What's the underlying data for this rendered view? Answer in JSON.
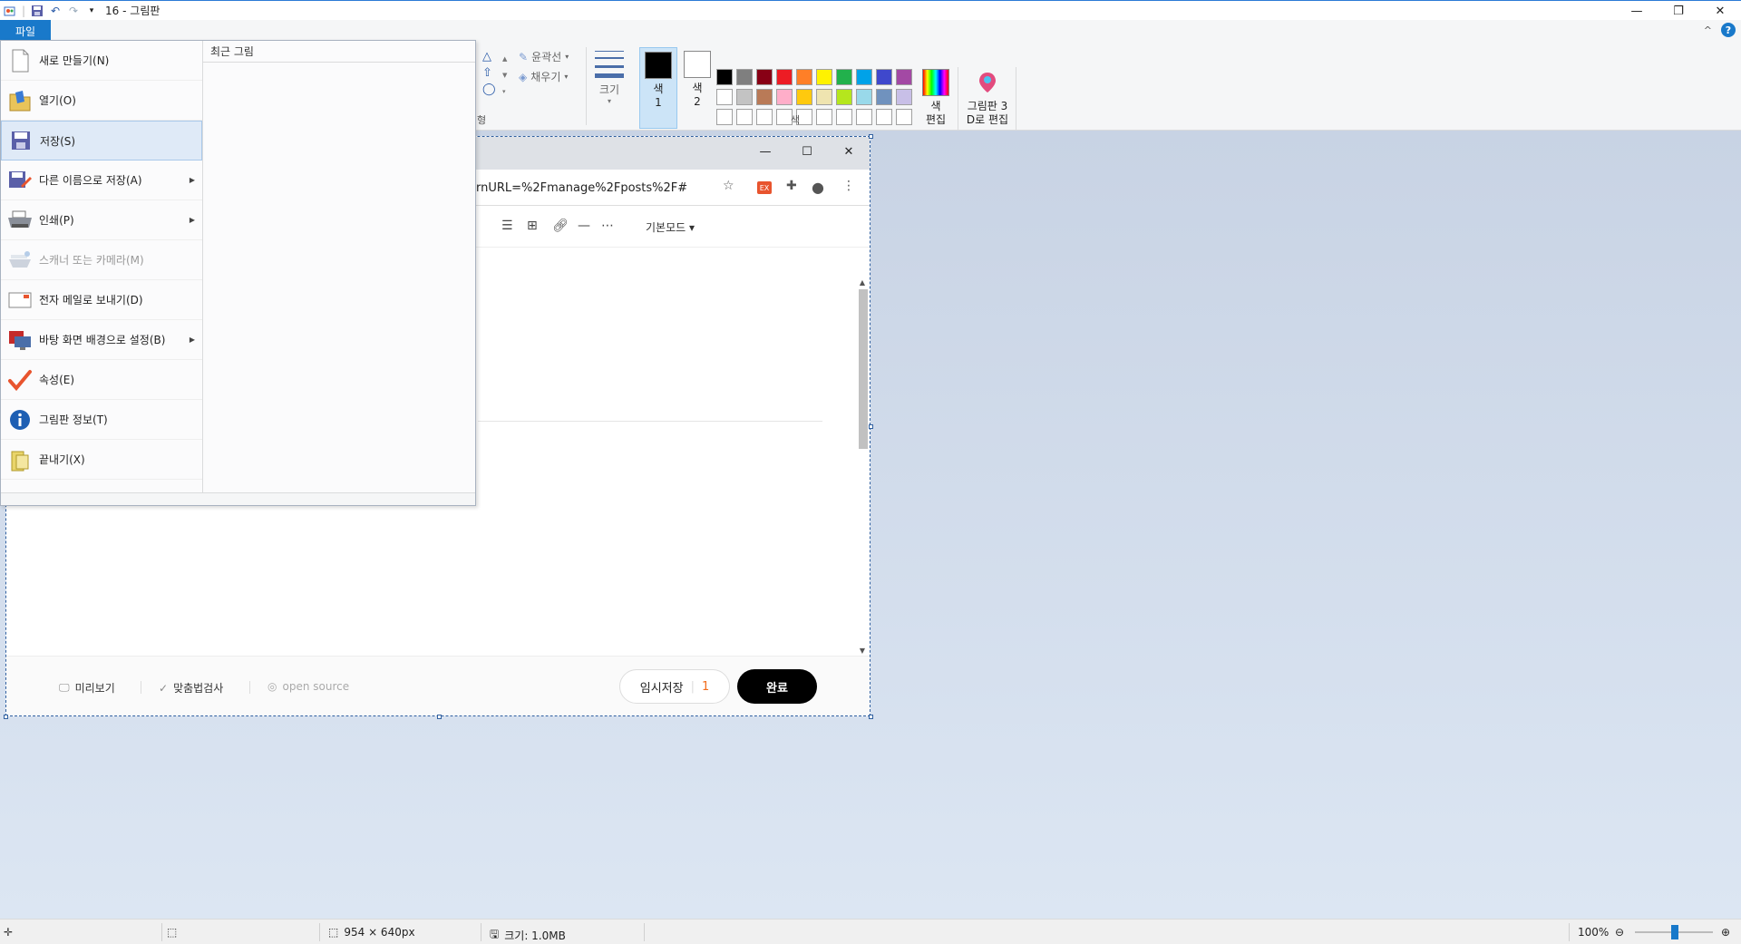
{
  "window": {
    "title": "16 - 그림판",
    "minimize": "—",
    "restore": "❐",
    "close": "✕"
  },
  "ribbon": {
    "file_tab": "파일",
    "collapse": "^",
    "help": "?",
    "shapes_caption": "형",
    "outline_label": "윤곽선",
    "fill_label": "채우기",
    "size_label": "크기",
    "color1_label_a": "색",
    "color1_label_b": "1",
    "color2_label_a": "색",
    "color2_label_b": "2",
    "colors_caption": "색",
    "edit_colors_a": "색",
    "edit_colors_b": "편집",
    "paint3d_a": "그림판 3",
    "paint3d_b": "D로 편집",
    "palette": [
      "#000000",
      "#7f7f7f",
      "#880015",
      "#ed1c24",
      "#ff7f27",
      "#fff200",
      "#22b14c",
      "#00a2e8",
      "#3f48cc",
      "#a349a4",
      "#ffffff",
      "#c3c3c3",
      "#b97a57",
      "#ffaec9",
      "#ffc90e",
      "#efe4b0",
      "#b5e61d",
      "#99d9ea",
      "#7092be",
      "#c8bfe7",
      "#ffffff",
      "#ffffff",
      "#ffffff",
      "#ffffff",
      "#ffffff",
      "#ffffff",
      "#ffffff",
      "#ffffff",
      "#ffffff",
      "#ffffff"
    ],
    "color1": "#000000",
    "color2": "#ffffff"
  },
  "file_menu": {
    "recent_title": "최근 그림",
    "items": [
      {
        "label": "새로 만들기(N)",
        "icon": "new-file-icon"
      },
      {
        "label": "열기(O)",
        "icon": "open-folder-icon"
      },
      {
        "label": "저장(S)",
        "icon": "save-icon"
      },
      {
        "label": "다른 이름으로 저장(A)",
        "icon": "save-as-icon"
      },
      {
        "label": "인쇄(P)",
        "icon": "printer-icon"
      },
      {
        "label": "스캐너 또는 카메라(M)",
        "icon": "scanner-icon"
      },
      {
        "label": "전자 메일로 보내기(D)",
        "icon": "email-icon"
      },
      {
        "label": "바탕 화면 배경으로 설정(B)",
        "icon": "desktop-background-icon"
      },
      {
        "label": "속성(E)",
        "icon": "checkmark-icon"
      },
      {
        "label": "그림판 정보(T)",
        "icon": "info-icon"
      },
      {
        "label": "끝내기(X)",
        "icon": "exit-icon"
      }
    ]
  },
  "captured": {
    "address": "rnURL=%2Fmanage%2Fposts%2F#",
    "mode": "기본모드",
    "preview": "미리보기",
    "spellcheck": "맞춤법검사",
    "open_source": "open source",
    "temp_save": "임시저장",
    "temp_count": "1",
    "done": "완료"
  },
  "status": {
    "dimensions": "954 × 640px",
    "size": "크기: 1.0MB",
    "zoom": "100%"
  }
}
